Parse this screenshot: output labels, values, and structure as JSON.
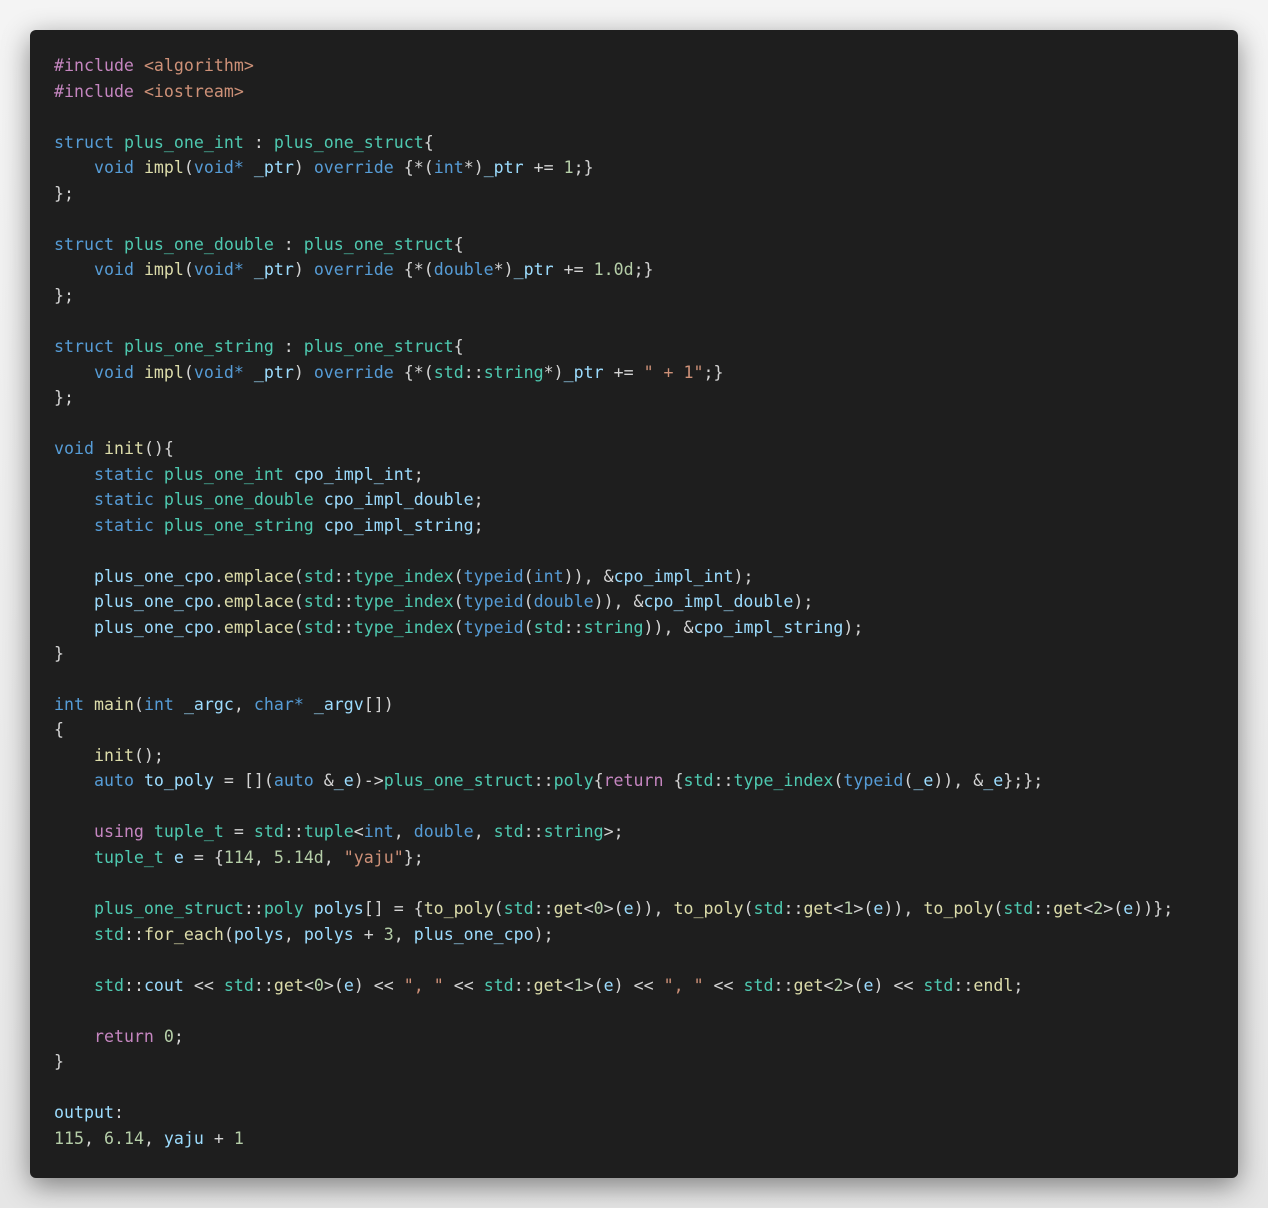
{
  "code_lines": [
    [
      [
        "ctl",
        "#include"
      ],
      [
        "pl",
        " "
      ],
      [
        "str",
        "<algorithm>"
      ]
    ],
    [
      [
        "ctl",
        "#include"
      ],
      [
        "pl",
        " "
      ],
      [
        "str",
        "<iostream>"
      ]
    ],
    [],
    [
      [
        "kw",
        "struct"
      ],
      [
        "pl",
        " "
      ],
      [
        "ty",
        "plus_one_int"
      ],
      [
        "pl",
        " : "
      ],
      [
        "ty",
        "plus_one_struct"
      ],
      [
        "pl",
        "{"
      ]
    ],
    [
      [
        "pl",
        "    "
      ],
      [
        "kw",
        "void"
      ],
      [
        "pl",
        " "
      ],
      [
        "fn",
        "impl"
      ],
      [
        "pl",
        "("
      ],
      [
        "kw",
        "void*"
      ],
      [
        "pl",
        " "
      ],
      [
        "var",
        "_ptr"
      ],
      [
        "pl",
        ") "
      ],
      [
        "kw",
        "override"
      ],
      [
        "pl",
        " {*("
      ],
      [
        "kw",
        "int"
      ],
      [
        "pl",
        "*)"
      ],
      [
        "var",
        "_ptr"
      ],
      [
        "pl",
        " += "
      ],
      [
        "num",
        "1"
      ],
      [
        "pl",
        ";}"
      ]
    ],
    [
      [
        "pl",
        "};"
      ]
    ],
    [],
    [
      [
        "kw",
        "struct"
      ],
      [
        "pl",
        " "
      ],
      [
        "ty",
        "plus_one_double"
      ],
      [
        "pl",
        " : "
      ],
      [
        "ty",
        "plus_one_struct"
      ],
      [
        "pl",
        "{"
      ]
    ],
    [
      [
        "pl",
        "    "
      ],
      [
        "kw",
        "void"
      ],
      [
        "pl",
        " "
      ],
      [
        "fn",
        "impl"
      ],
      [
        "pl",
        "("
      ],
      [
        "kw",
        "void*"
      ],
      [
        "pl",
        " "
      ],
      [
        "var",
        "_ptr"
      ],
      [
        "pl",
        ") "
      ],
      [
        "kw",
        "override"
      ],
      [
        "pl",
        " {*("
      ],
      [
        "kw",
        "double"
      ],
      [
        "pl",
        "*)"
      ],
      [
        "var",
        "_ptr"
      ],
      [
        "pl",
        " += "
      ],
      [
        "num",
        "1.0d"
      ],
      [
        "pl",
        ";}"
      ]
    ],
    [
      [
        "pl",
        "};"
      ]
    ],
    [],
    [
      [
        "kw",
        "struct"
      ],
      [
        "pl",
        " "
      ],
      [
        "ty",
        "plus_one_string"
      ],
      [
        "pl",
        " : "
      ],
      [
        "ty",
        "plus_one_struct"
      ],
      [
        "pl",
        "{"
      ]
    ],
    [
      [
        "pl",
        "    "
      ],
      [
        "kw",
        "void"
      ],
      [
        "pl",
        " "
      ],
      [
        "fn",
        "impl"
      ],
      [
        "pl",
        "("
      ],
      [
        "kw",
        "void*"
      ],
      [
        "pl",
        " "
      ],
      [
        "var",
        "_ptr"
      ],
      [
        "pl",
        ") "
      ],
      [
        "kw",
        "override"
      ],
      [
        "pl",
        " {*("
      ],
      [
        "ty",
        "std"
      ],
      [
        "pl",
        "::"
      ],
      [
        "ty",
        "string"
      ],
      [
        "pl",
        "*)"
      ],
      [
        "var",
        "_ptr"
      ],
      [
        "pl",
        " += "
      ],
      [
        "str",
        "\" + 1\""
      ],
      [
        "pl",
        ";}"
      ]
    ],
    [
      [
        "pl",
        "};"
      ]
    ],
    [],
    [
      [
        "kw",
        "void"
      ],
      [
        "pl",
        " "
      ],
      [
        "fn",
        "init"
      ],
      [
        "pl",
        "(){"
      ]
    ],
    [
      [
        "pl",
        "    "
      ],
      [
        "kw",
        "static"
      ],
      [
        "pl",
        " "
      ],
      [
        "ty",
        "plus_one_int"
      ],
      [
        "pl",
        " "
      ],
      [
        "var",
        "cpo_impl_int"
      ],
      [
        "pl",
        ";"
      ]
    ],
    [
      [
        "pl",
        "    "
      ],
      [
        "kw",
        "static"
      ],
      [
        "pl",
        " "
      ],
      [
        "ty",
        "plus_one_double"
      ],
      [
        "pl",
        " "
      ],
      [
        "var",
        "cpo_impl_double"
      ],
      [
        "pl",
        ";"
      ]
    ],
    [
      [
        "pl",
        "    "
      ],
      [
        "kw",
        "static"
      ],
      [
        "pl",
        " "
      ],
      [
        "ty",
        "plus_one_string"
      ],
      [
        "pl",
        " "
      ],
      [
        "var",
        "cpo_impl_string"
      ],
      [
        "pl",
        ";"
      ]
    ],
    [],
    [
      [
        "pl",
        "    "
      ],
      [
        "var",
        "plus_one_cpo"
      ],
      [
        "pl",
        "."
      ],
      [
        "fn",
        "emplace"
      ],
      [
        "pl",
        "("
      ],
      [
        "ty",
        "std"
      ],
      [
        "pl",
        "::"
      ],
      [
        "ty",
        "type_index"
      ],
      [
        "pl",
        "("
      ],
      [
        "kw",
        "typeid"
      ],
      [
        "pl",
        "("
      ],
      [
        "kw",
        "int"
      ],
      [
        "pl",
        ")), &"
      ],
      [
        "var",
        "cpo_impl_int"
      ],
      [
        "pl",
        ");"
      ]
    ],
    [
      [
        "pl",
        "    "
      ],
      [
        "var",
        "plus_one_cpo"
      ],
      [
        "pl",
        "."
      ],
      [
        "fn",
        "emplace"
      ],
      [
        "pl",
        "("
      ],
      [
        "ty",
        "std"
      ],
      [
        "pl",
        "::"
      ],
      [
        "ty",
        "type_index"
      ],
      [
        "pl",
        "("
      ],
      [
        "kw",
        "typeid"
      ],
      [
        "pl",
        "("
      ],
      [
        "kw",
        "double"
      ],
      [
        "pl",
        ")), &"
      ],
      [
        "var",
        "cpo_impl_double"
      ],
      [
        "pl",
        ");"
      ]
    ],
    [
      [
        "pl",
        "    "
      ],
      [
        "var",
        "plus_one_cpo"
      ],
      [
        "pl",
        "."
      ],
      [
        "fn",
        "emplace"
      ],
      [
        "pl",
        "("
      ],
      [
        "ty",
        "std"
      ],
      [
        "pl",
        "::"
      ],
      [
        "ty",
        "type_index"
      ],
      [
        "pl",
        "("
      ],
      [
        "kw",
        "typeid"
      ],
      [
        "pl",
        "("
      ],
      [
        "ty",
        "std"
      ],
      [
        "pl",
        "::"
      ],
      [
        "ty",
        "string"
      ],
      [
        "pl",
        ")), &"
      ],
      [
        "var",
        "cpo_impl_string"
      ],
      [
        "pl",
        ");"
      ]
    ],
    [
      [
        "pl",
        "}"
      ]
    ],
    [],
    [
      [
        "kw",
        "int"
      ],
      [
        "pl",
        " "
      ],
      [
        "fn",
        "main"
      ],
      [
        "pl",
        "("
      ],
      [
        "kw",
        "int"
      ],
      [
        "pl",
        " "
      ],
      [
        "var",
        "_argc"
      ],
      [
        "pl",
        ", "
      ],
      [
        "kw",
        "char*"
      ],
      [
        "pl",
        " "
      ],
      [
        "var",
        "_argv"
      ],
      [
        "pl",
        "[])"
      ]
    ],
    [
      [
        "pl",
        "{"
      ]
    ],
    [
      [
        "pl",
        "    "
      ],
      [
        "fn",
        "init"
      ],
      [
        "pl",
        "();"
      ]
    ],
    [
      [
        "pl",
        "    "
      ],
      [
        "kw",
        "auto"
      ],
      [
        "pl",
        " "
      ],
      [
        "var",
        "to_poly"
      ],
      [
        "pl",
        " = []("
      ],
      [
        "kw",
        "auto"
      ],
      [
        "pl",
        " &"
      ],
      [
        "var",
        "_e"
      ],
      [
        "pl",
        ")->"
      ],
      [
        "ty",
        "plus_one_struct"
      ],
      [
        "pl",
        "::"
      ],
      [
        "ty",
        "poly"
      ],
      [
        "pl",
        "{"
      ],
      [
        "ctl",
        "return"
      ],
      [
        "pl",
        " {"
      ],
      [
        "ty",
        "std"
      ],
      [
        "pl",
        "::"
      ],
      [
        "ty",
        "type_index"
      ],
      [
        "pl",
        "("
      ],
      [
        "kw",
        "typeid"
      ],
      [
        "pl",
        "("
      ],
      [
        "var",
        "_e"
      ],
      [
        "pl",
        ")), &"
      ],
      [
        "var",
        "_e"
      ],
      [
        "pl",
        "};};"
      ]
    ],
    [],
    [
      [
        "pl",
        "    "
      ],
      [
        "ctl",
        "using"
      ],
      [
        "pl",
        " "
      ],
      [
        "ty",
        "tuple_t"
      ],
      [
        "pl",
        " = "
      ],
      [
        "ty",
        "std"
      ],
      [
        "pl",
        "::"
      ],
      [
        "ty",
        "tuple"
      ],
      [
        "pl",
        "<"
      ],
      [
        "kw",
        "int"
      ],
      [
        "pl",
        ", "
      ],
      [
        "kw",
        "double"
      ],
      [
        "pl",
        ", "
      ],
      [
        "ty",
        "std"
      ],
      [
        "pl",
        "::"
      ],
      [
        "ty",
        "string"
      ],
      [
        "pl",
        ">;"
      ]
    ],
    [
      [
        "pl",
        "    "
      ],
      [
        "ty",
        "tuple_t"
      ],
      [
        "pl",
        " "
      ],
      [
        "var",
        "e"
      ],
      [
        "pl",
        " = {"
      ],
      [
        "num",
        "114"
      ],
      [
        "pl",
        ", "
      ],
      [
        "num",
        "5.14d"
      ],
      [
        "pl",
        ", "
      ],
      [
        "str",
        "\"yaju\""
      ],
      [
        "pl",
        "};"
      ]
    ],
    [],
    [
      [
        "pl",
        "    "
      ],
      [
        "ty",
        "plus_one_struct"
      ],
      [
        "pl",
        "::"
      ],
      [
        "ty",
        "poly"
      ],
      [
        "pl",
        " "
      ],
      [
        "var",
        "polys"
      ],
      [
        "pl",
        "[] = {"
      ],
      [
        "fn",
        "to_poly"
      ],
      [
        "pl",
        "("
      ],
      [
        "ty",
        "std"
      ],
      [
        "pl",
        "::"
      ],
      [
        "fn",
        "get"
      ],
      [
        "pl",
        "<"
      ],
      [
        "num",
        "0"
      ],
      [
        "pl",
        ">("
      ],
      [
        "var",
        "e"
      ],
      [
        "pl",
        ")), "
      ],
      [
        "fn",
        "to_poly"
      ],
      [
        "pl",
        "("
      ],
      [
        "ty",
        "std"
      ],
      [
        "pl",
        "::"
      ],
      [
        "fn",
        "get"
      ],
      [
        "pl",
        "<"
      ],
      [
        "num",
        "1"
      ],
      [
        "pl",
        ">("
      ],
      [
        "var",
        "e"
      ],
      [
        "pl",
        ")), "
      ],
      [
        "fn",
        "to_poly"
      ],
      [
        "pl",
        "("
      ],
      [
        "ty",
        "std"
      ],
      [
        "pl",
        "::"
      ],
      [
        "fn",
        "get"
      ],
      [
        "pl",
        "<"
      ],
      [
        "num",
        "2"
      ],
      [
        "pl",
        ">("
      ],
      [
        "var",
        "e"
      ],
      [
        "pl",
        "))};"
      ]
    ],
    [
      [
        "pl",
        "    "
      ],
      [
        "ty",
        "std"
      ],
      [
        "pl",
        "::"
      ],
      [
        "fn",
        "for_each"
      ],
      [
        "pl",
        "("
      ],
      [
        "var",
        "polys"
      ],
      [
        "pl",
        ", "
      ],
      [
        "var",
        "polys"
      ],
      [
        "pl",
        " + "
      ],
      [
        "num",
        "3"
      ],
      [
        "pl",
        ", "
      ],
      [
        "var",
        "plus_one_cpo"
      ],
      [
        "pl",
        ");"
      ]
    ],
    [],
    [
      [
        "pl",
        "    "
      ],
      [
        "ty",
        "std"
      ],
      [
        "pl",
        "::"
      ],
      [
        "var",
        "cout"
      ],
      [
        "pl",
        " << "
      ],
      [
        "ty",
        "std"
      ],
      [
        "pl",
        "::"
      ],
      [
        "fn",
        "get"
      ],
      [
        "pl",
        "<"
      ],
      [
        "num",
        "0"
      ],
      [
        "pl",
        ">("
      ],
      [
        "var",
        "e"
      ],
      [
        "pl",
        ") << "
      ],
      [
        "str",
        "\", \""
      ],
      [
        "pl",
        " << "
      ],
      [
        "ty",
        "std"
      ],
      [
        "pl",
        "::"
      ],
      [
        "fn",
        "get"
      ],
      [
        "pl",
        "<"
      ],
      [
        "num",
        "1"
      ],
      [
        "pl",
        ">("
      ],
      [
        "var",
        "e"
      ],
      [
        "pl",
        ") << "
      ],
      [
        "str",
        "\", \""
      ],
      [
        "pl",
        " << "
      ],
      [
        "ty",
        "std"
      ],
      [
        "pl",
        "::"
      ],
      [
        "fn",
        "get"
      ],
      [
        "pl",
        "<"
      ],
      [
        "num",
        "2"
      ],
      [
        "pl",
        ">("
      ],
      [
        "var",
        "e"
      ],
      [
        "pl",
        ") << "
      ],
      [
        "ty",
        "std"
      ],
      [
        "pl",
        "::"
      ],
      [
        "fn",
        "endl"
      ],
      [
        "pl",
        ";"
      ]
    ],
    [],
    [
      [
        "pl",
        "    "
      ],
      [
        "ctl",
        "return"
      ],
      [
        "pl",
        " "
      ],
      [
        "num",
        "0"
      ],
      [
        "pl",
        ";"
      ]
    ],
    [
      [
        "pl",
        "}"
      ]
    ],
    [],
    [
      [
        "var",
        "output"
      ],
      [
        "pl",
        ":"
      ]
    ],
    [
      [
        "num",
        "115"
      ],
      [
        "pl",
        ", "
      ],
      [
        "num",
        "6.14"
      ],
      [
        "pl",
        ", "
      ],
      [
        "var",
        "yaju"
      ],
      [
        "pl",
        " + "
      ],
      [
        "num",
        "1"
      ]
    ]
  ]
}
